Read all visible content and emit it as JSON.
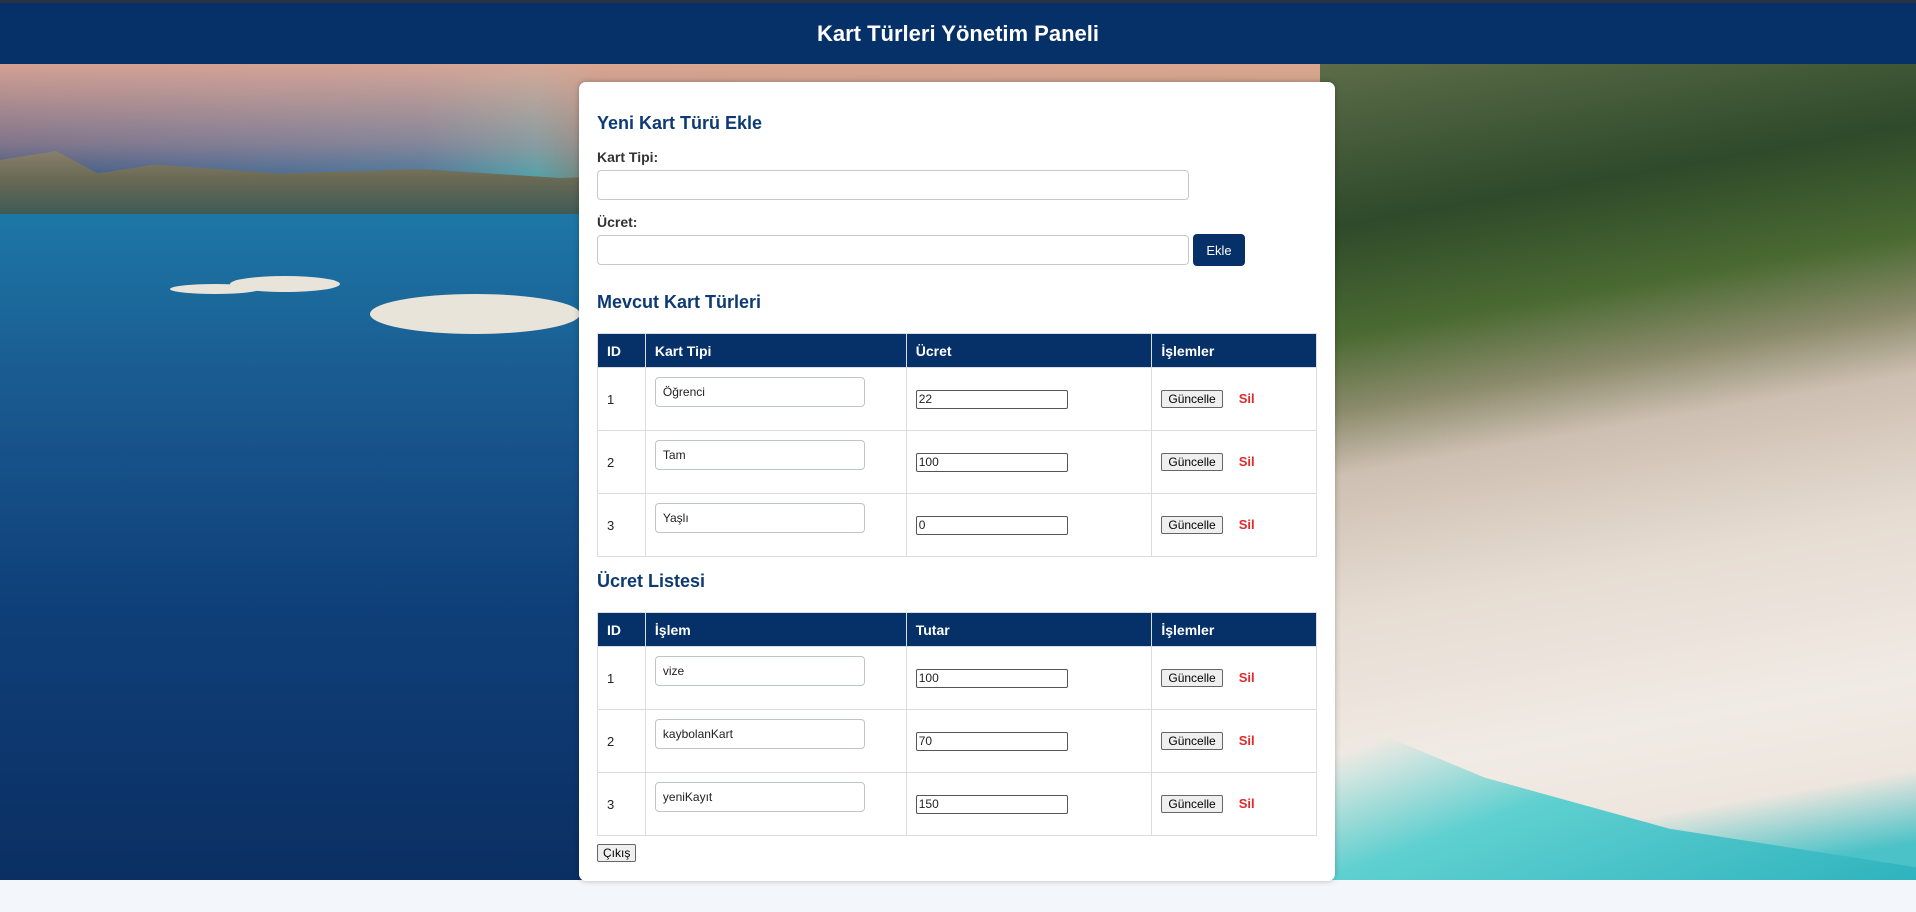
{
  "header": {
    "title": "Kart Türleri Yönetim Paneli"
  },
  "add_form": {
    "heading": "Yeni Kart Türü Ekle",
    "type_label": "Kart Tipi:",
    "type_value": "",
    "fee_label": "Ücret:",
    "fee_value": "",
    "add_label": "Ekle"
  },
  "card_types": {
    "heading": "Mevcut Kart Türleri",
    "columns": [
      "ID",
      "Kart Tipi",
      "Ücret",
      "İşlemler"
    ],
    "rows": [
      {
        "id": "1",
        "name": "Öğrenci",
        "fee": "22",
        "update": "Güncelle",
        "delete": "Sil"
      },
      {
        "id": "2",
        "name": "Tam",
        "fee": "100",
        "update": "Güncelle",
        "delete": "Sil"
      },
      {
        "id": "3",
        "name": "Yaşlı",
        "fee": "0",
        "update": "Güncelle",
        "delete": "Sil"
      }
    ]
  },
  "fee_list": {
    "heading": "Ücret Listesi",
    "columns": [
      "ID",
      "İşlem",
      "Tutar",
      "İşlemler"
    ],
    "rows": [
      {
        "id": "1",
        "name": "vize",
        "amount": "100",
        "update": "Güncelle",
        "delete": "Sil"
      },
      {
        "id": "2",
        "name": "kaybolanKart",
        "amount": "70",
        "update": "Güncelle",
        "delete": "Sil"
      },
      {
        "id": "3",
        "name": "yeniKayıt",
        "amount": "150",
        "update": "Güncelle",
        "delete": "Sil"
      }
    ]
  },
  "exit_label": "Çıkış",
  "colors": {
    "primary": "#063068",
    "danger": "#e02b2b",
    "panel": "#ffffff"
  }
}
